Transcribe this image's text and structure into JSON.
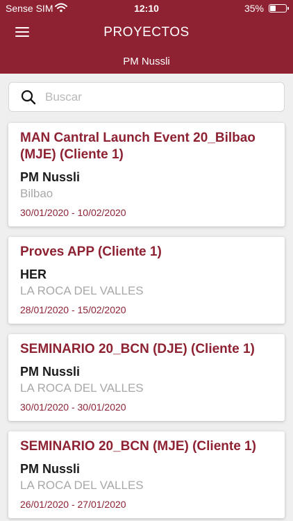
{
  "status_bar": {
    "carrier": "Sense SIM",
    "time": "12:10",
    "battery": "35%",
    "battery_level": 0.35
  },
  "header": {
    "title": "PROYECTOS",
    "subtitle": "PM Nussli",
    "menu_icon": "hamburger-menu-icon",
    "color": "#8e2233"
  },
  "search": {
    "placeholder": "Buscar",
    "value": "",
    "icon": "search-icon"
  },
  "projects": [
    {
      "title": "MAN Cantral Launch Event 20_Bilbao (MJE) (Cliente 1)",
      "manager": "PM Nussli",
      "location": "Bilbao",
      "dates": "30/01/2020 - 10/02/2020"
    },
    {
      "title": "Proves APP (Cliente 1)",
      "manager": "HER",
      "location": "LA ROCA DEL VALLES",
      "dates": "28/01/2020 - 15/02/2020"
    },
    {
      "title": "SEMINARIO 20_BCN (DJE) (Cliente 1)",
      "manager": "PM Nussli",
      "location": "LA ROCA DEL VALLES",
      "dates": "30/01/2020 - 30/01/2020"
    },
    {
      "title": "SEMINARIO 20_BCN (MJE) (Cliente 1)",
      "manager": "PM Nussli",
      "location": "LA ROCA DEL VALLES",
      "dates": "26/01/2020 - 27/01/2020"
    }
  ]
}
